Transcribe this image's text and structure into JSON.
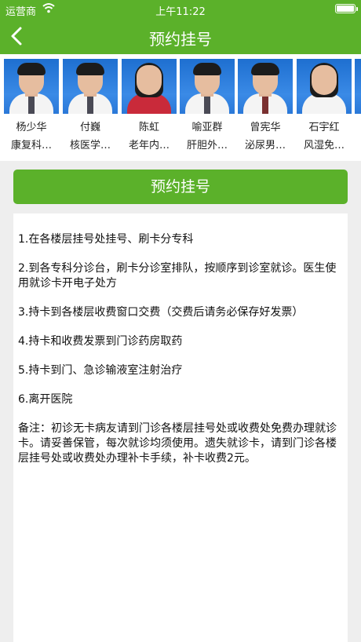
{
  "status_bar": {
    "carrier": "运营商",
    "time": "上午11:22"
  },
  "nav": {
    "title": "预约挂号",
    "back_icon": "chevron-left-icon"
  },
  "colors": {
    "brand_green": "#5bb12a"
  },
  "doctors": [
    {
      "name": "杨少华",
      "dept": "康复科…"
    },
    {
      "name": "付巍",
      "dept": "核医学…"
    },
    {
      "name": "陈虹",
      "dept": "老年内…"
    },
    {
      "name": "喻亚群",
      "dept": "肝胆外…"
    },
    {
      "name": "曾宪华",
      "dept": "泌尿男…"
    },
    {
      "name": "石宇红",
      "dept": "风湿免…"
    }
  ],
  "book_button": {
    "label": "预约挂号"
  },
  "notice": {
    "items": [
      "1.在各楼层挂号处挂号、刷卡分专科",
      "2.到各专科分诊台，刷卡分诊室排队，按顺序到诊室就诊。医生使用就诊卡开电子处方",
      "3.持卡到各楼层收费窗口交费（交费后请务必保存好发票）",
      "4.持卡和收费发票到门诊药房取药",
      "5.持卡到门、急诊输液室注射治疗",
      "6.离开医院",
      "备注：初诊无卡病友请到门诊各楼层挂号处或收费处免费办理就诊卡。请妥善保管，每次就诊均须使用。遗失就诊卡，请到门诊各楼层挂号处或收费处办理补卡手续，补卡收费2元。"
    ]
  }
}
